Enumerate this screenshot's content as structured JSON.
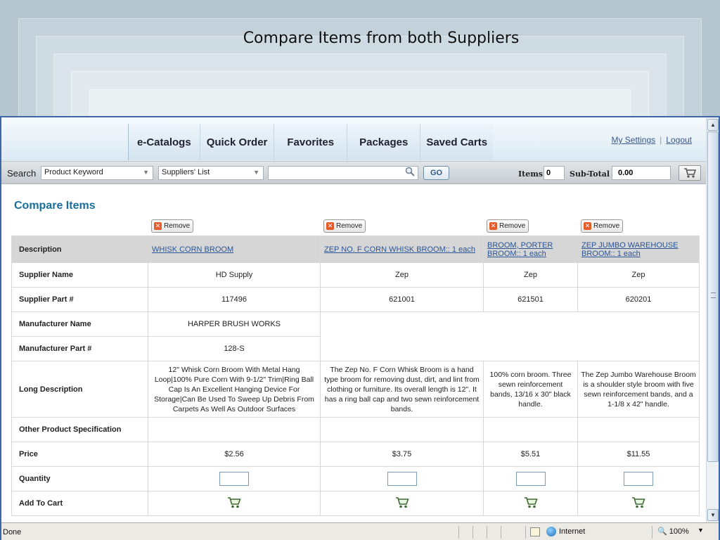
{
  "slide": {
    "title": "Compare Items from both Suppliers"
  },
  "nav": {
    "tabs": [
      "e-Catalogs",
      "Quick Order",
      "Favorites",
      "Packages",
      "Saved Carts"
    ],
    "my_settings": "My Settings",
    "separator": "|",
    "logout": "Logout"
  },
  "search": {
    "label": "Search",
    "type_selected": "Product Keyword",
    "supplier_selected": "Suppliers' List",
    "query": "",
    "go_label": "GO",
    "items_label": "Items",
    "items_value": "0",
    "subtotal_label": "Sub-Total",
    "subtotal_value": "0.00"
  },
  "compare": {
    "title": "Compare Items",
    "remove_label": "Remove",
    "row_labels": {
      "description": "Description",
      "supplier_name": "Supplier Name",
      "supplier_part": "Supplier Part #",
      "manufacturer_name": "Manufacturer Name",
      "manufacturer_part": "Manufacturer Part #",
      "long_description": "Long Description",
      "other_spec": "Other Product Specification",
      "price": "Price",
      "quantity": "Quantity",
      "add_to_cart": "Add To Cart"
    },
    "items": [
      {
        "description_line1": "WHISK CORN BROOM",
        "description_line2": "",
        "supplier_name": "HD Supply",
        "supplier_part": "117496",
        "manufacturer_name": "HARPER BRUSH WORKS",
        "manufacturer_part": "128-S",
        "long_description": "12\" Whisk Corn Broom With Metal Hang Loop|100% Pure Corn With 9-1/2\" Trim|Ring Ball Cap Is An Excellent Hanging Device For Storage|Can Be Used To Sweep Up Debris From Carpets As Well As Outdoor Surfaces",
        "other_spec": "",
        "price": "$2.56"
      },
      {
        "description_line1": "ZEP NO. F CORN WHISK BROOM::  1 each",
        "description_line2": "",
        "supplier_name": "Zep",
        "supplier_part": "621001",
        "manufacturer_name": "",
        "manufacturer_part": "",
        "long_description": "The Zep No. F Corn Whisk Broom is a hand type broom for removing dust, dirt, and lint from clothing or furniture. Its overall length is 12\". It has a ring ball cap and two sewn reinforcement bands.",
        "other_spec": "",
        "price": "$3.75"
      },
      {
        "description_line1": "BROOM, PORTER",
        "description_line2": "BROOM::  1 each",
        "supplier_name": "Zep",
        "supplier_part": "621501",
        "manufacturer_name": "",
        "manufacturer_part": "",
        "long_description": "100% corn broom. Three sewn reinforcement bands, 13/16 x 30\" black handle.",
        "other_spec": "",
        "price": "$5.51"
      },
      {
        "description_line1": "ZEP JUMBO WAREHOUSE",
        "description_line2": "BROOM::  1 each",
        "supplier_name": "Zep",
        "supplier_part": "620201",
        "manufacturer_name": "",
        "manufacturer_part": "",
        "long_description": "The Zep Jumbo Warehouse Broom is a shoulder style broom with five sewn reinforcement bands, and a 1-1/8 x 42\" handle.",
        "other_spec": "",
        "price": "$11.55"
      }
    ]
  },
  "status": {
    "left": "Done",
    "zone": "Internet",
    "zoom": "100%"
  },
  "colors": {
    "heading_blue": "#1a6e9e",
    "link_blue": "#2a5597",
    "remove_red": "#e55b2a",
    "browser_border": "#3e66a6"
  },
  "icons": [
    "magnifier-icon",
    "cart-icon",
    "remove-x-icon",
    "globe-icon",
    "security-icon",
    "zoom-icon"
  ]
}
